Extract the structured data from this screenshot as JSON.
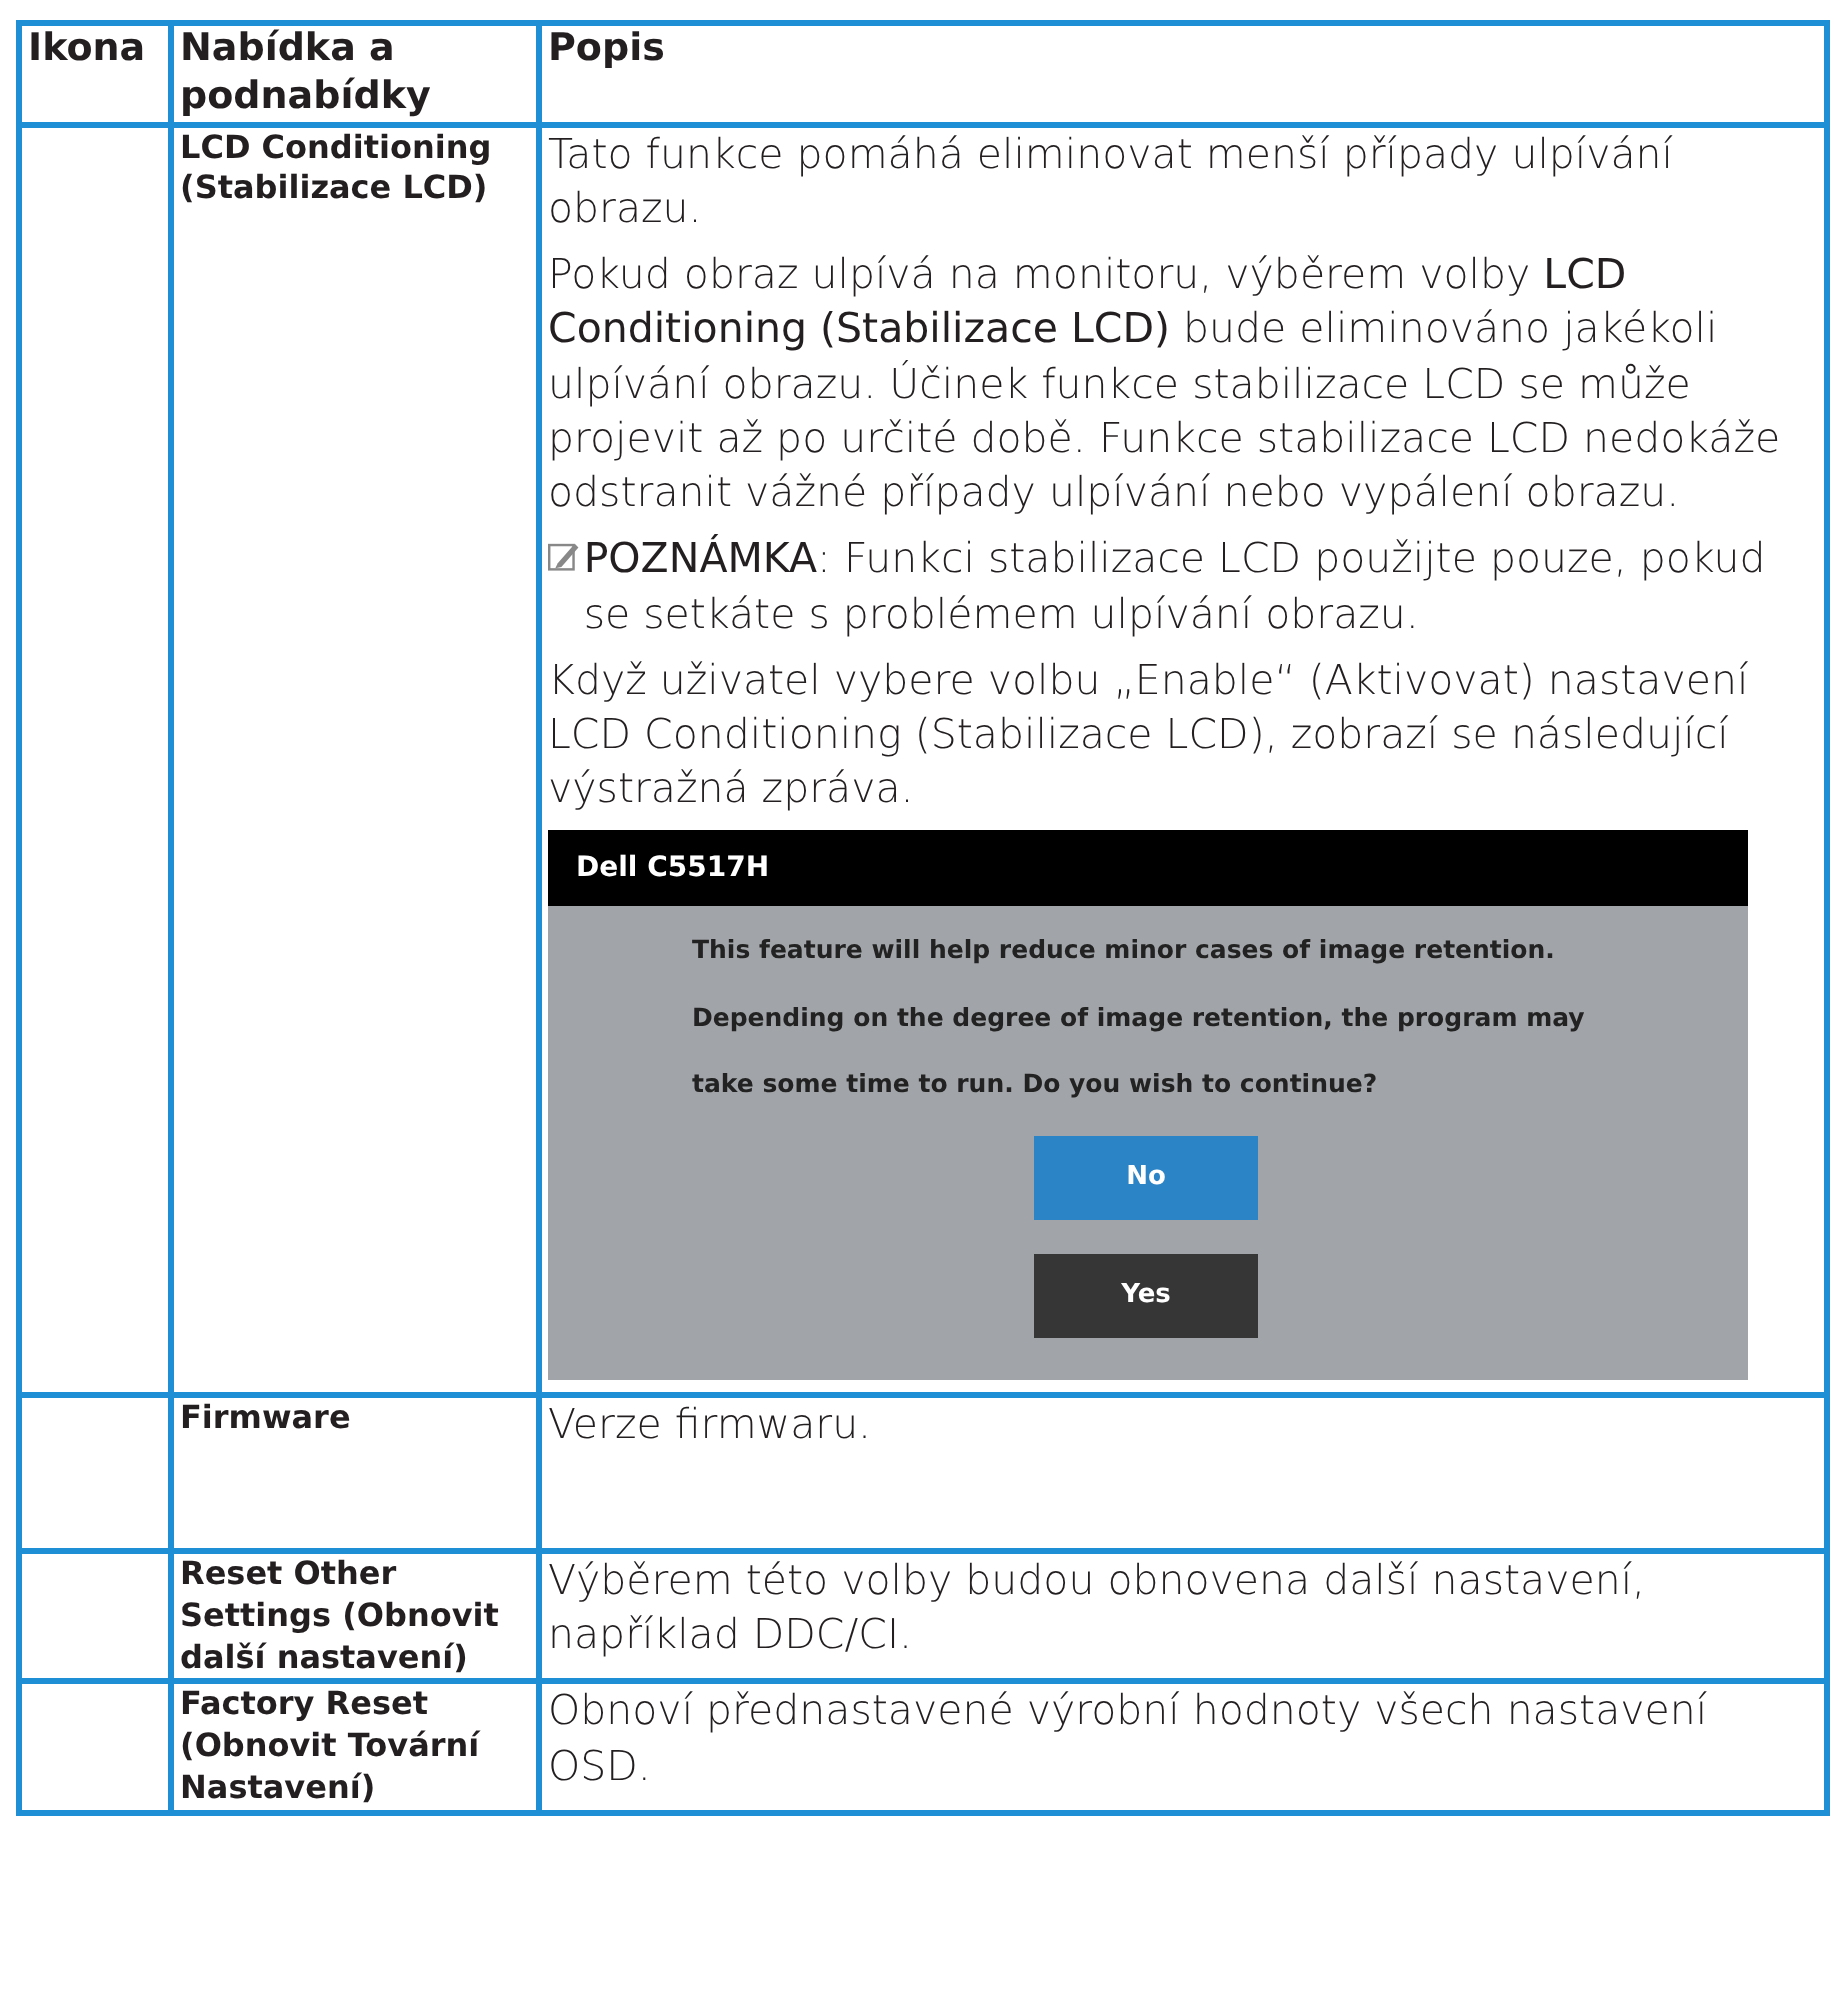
{
  "table": {
    "columns": [
      "Ikona",
      "Nabídka a podnabídky",
      "Popis"
    ],
    "rows": [
      {
        "menu": "LCD Conditioning (Stabilizace LCD)",
        "description": [
          {
            "kind": "paragraph",
            "text": "Tato funkce pomáhá eliminovat menší případy ulpívání obrazu."
          },
          {
            "kind": "paragraph",
            "text": "Pokud obraz ulpívá na monitoru, výběrem volby **LCD Conditioning (Stabilizace LCD)** bude eliminováno jakékoli ulpívání obrazu. Účinek funkce stabilizace LCD se může projevit až po určité době. Funkce stabilizace LCD nedokáže odstranit vážné případy ulpívání nebo vypálení obrazu."
          },
          {
            "kind": "note",
            "text": "**POZNÁMKA**: Funkci stabilizace LCD použijte pouze, pokud se setkáte s problémem ulpívání obrazu."
          },
          {
            "kind": "paragraph",
            "text": "Když uživatel vybere volbu „Enable“ (Aktivovat) nastavení LCD Conditioning (Stabilizace LCD), zobrazí se následující výstražná zpráva."
          },
          {
            "kind": "dialog",
            "title": "Dell C5517H",
            "lines": [
              "This feature will help reduce minor cases of image retention.",
              "Depending on the degree of image retention, the program may",
              "take some time to run. Do you wish to continue?"
            ],
            "buttons": [
              {
                "label": "No",
                "selected": true
              },
              {
                "label": "Yes",
                "selected": false
              }
            ]
          }
        ]
      },
      {
        "menu": "Firmware",
        "description": [
          {
            "kind": "paragraph",
            "text": "Verze firmwaru."
          }
        ],
        "tall": true
      },
      {
        "menu": "Reset Other Settings (Obnovit další nastavení)",
        "description": [
          {
            "kind": "paragraph",
            "text": "Výběrem této volby budou obnovena další nastavení, například DDC/CI."
          }
        ]
      },
      {
        "menu": "Factory Reset (Obnovit Tovární Nastavení)",
        "description": [
          {
            "kind": "paragraph",
            "text": "Obnoví přednastavené výrobní hodnoty všech nastavení OSD."
          }
        ]
      }
    ]
  }
}
